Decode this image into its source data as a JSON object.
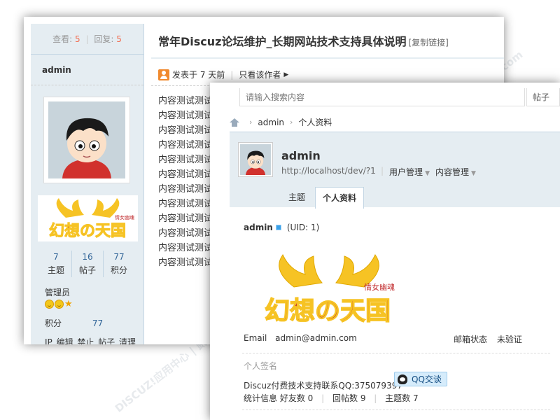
{
  "thread": {
    "views_label": "查看:",
    "views": "5",
    "replies_label": "回复:",
    "replies": "5",
    "title": "常年Discuz论坛维护_长期网站技术支持具体说明",
    "copy_link": "[复制链接]",
    "author": "admin",
    "posted": "发表于 7 天前",
    "only_author": "只看该作者",
    "body_lines": [
      "内容测试测试",
      "内容测试测试",
      "内容测试测试",
      "内容测试测试",
      "内容测试测试",
      "内容测试测试",
      "内容测试测试",
      "内容测试测试",
      "内容测试测试",
      "内容测试测试",
      "内容测试测试",
      "内容测试测试"
    ],
    "medal_text": "幻想の天国",
    "medal_subtext": "情女幽魂",
    "stats": [
      {
        "value": "7",
        "label": "主题"
      },
      {
        "value": "16",
        "label": "帖子"
      },
      {
        "value": "77",
        "label": "积分"
      }
    ],
    "role": "管理员",
    "credit_label": "积分",
    "credit_value": "77",
    "actions": "IP 编辑 禁止 帖子 清理"
  },
  "profile": {
    "search_placeholder": "请输入搜索内容",
    "search_button": "帖子",
    "breadcrumb": [
      "admin",
      "个人资料"
    ],
    "username": "admin",
    "url": "http://localhost/dev/?1",
    "menus": [
      "用户管理",
      "内容管理"
    ],
    "tabs": [
      "主题",
      "个人资料"
    ],
    "name_row": "admin",
    "uid": "(UID: 1)",
    "email_label": "Email",
    "email": "admin@admin.com",
    "mail_status_label": "邮箱状态",
    "mail_status": "未验证",
    "signature_label": "个人签名",
    "signature": "Discuz付费技术支持联系QQ:375079397",
    "qq_button": "QQ交谈",
    "stats_label": "统计信息",
    "friends": "好友数 0",
    "replies": "回帖数 9",
    "threads": "主题数 7"
  },
  "watermark": "DISCUZ!应用中心 | 贰道 addon.dismall.com",
  "colors": {
    "sidebar_bg": "#e5edf2",
    "border": "#c2d5e3",
    "accent_orange": "#f26c4f",
    "link_blue": "#336699",
    "medal_red": "#c0392b",
    "medal_yellow": "#f6c324"
  }
}
